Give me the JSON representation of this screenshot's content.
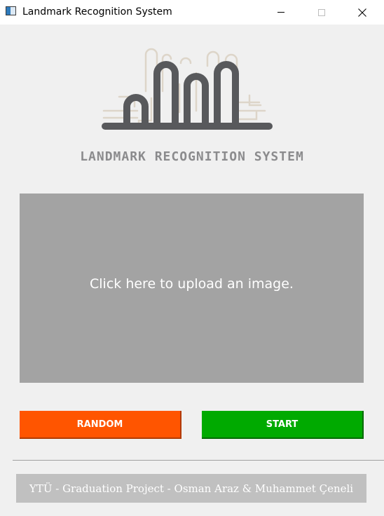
{
  "window": {
    "title": "Landmark Recognition System",
    "icon": "app-window-icon",
    "controls": [
      "minimize-icon",
      "maximize-icon",
      "close-icon"
    ]
  },
  "logo": {
    "icon": "landmark-arches-logo"
  },
  "heading": "LANDMARK RECOGNITION SYSTEM",
  "upload": {
    "prompt": "Click here to upload an image."
  },
  "buttons": {
    "random_label": "RANDOM",
    "start_label": "START"
  },
  "footer": {
    "text": "YTÜ - Graduation Project - Osman Araz & Muhammet Çeneli"
  },
  "colors": {
    "random": "#ff5500",
    "start": "#00aa00",
    "upload_area": "#a3a3a3",
    "footer": "#c0c0c0",
    "heading": "#8b8b8d",
    "logo_dark": "#58595c",
    "logo_light": "#ddd5c9"
  }
}
